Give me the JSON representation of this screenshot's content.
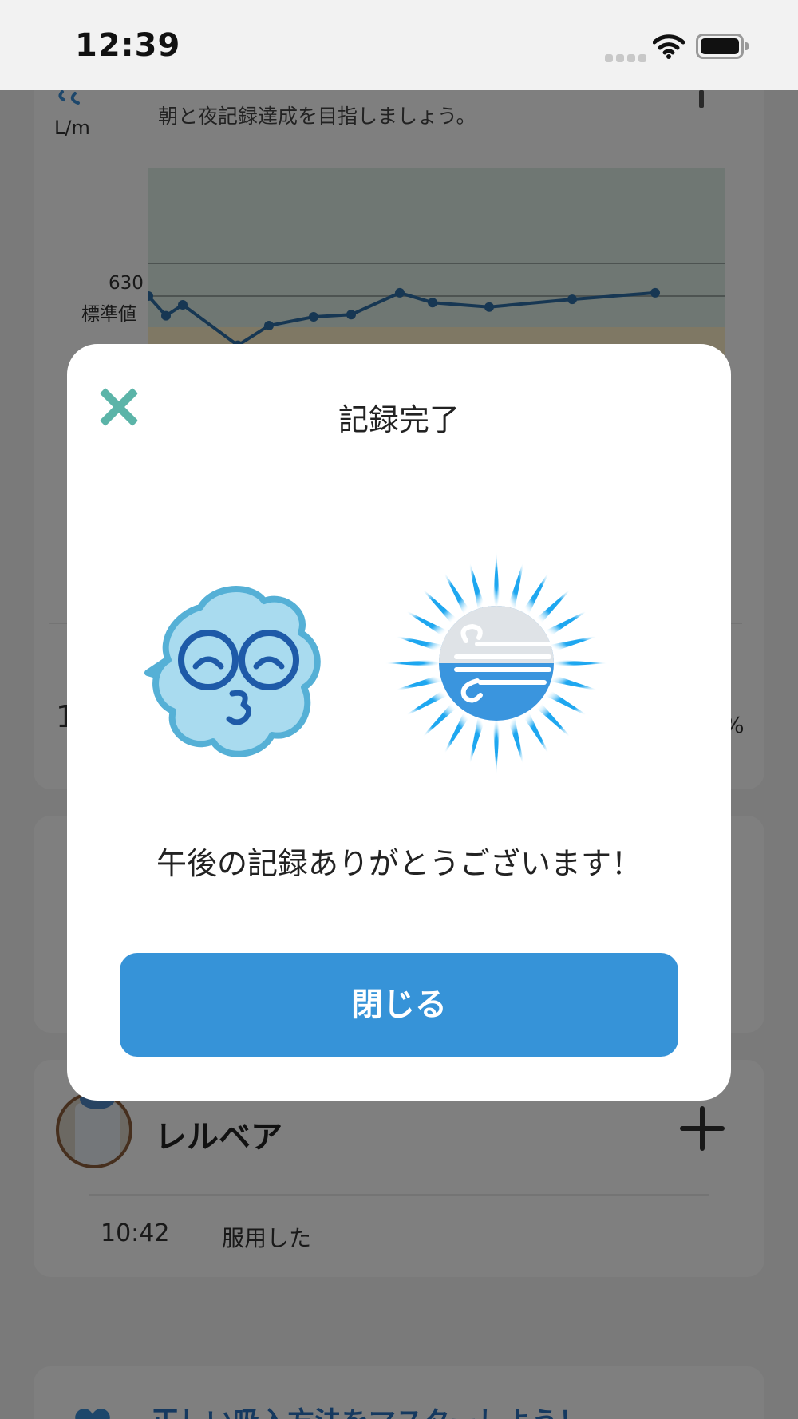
{
  "status_bar": {
    "time": "12:39"
  },
  "chart_card": {
    "unit": "L/m",
    "message": "朝と夜記録達成を目指しましょう。",
    "y_value_label": "630",
    "y_std_label": "標準値",
    "left_digit": "1",
    "right_suffix": "%"
  },
  "chart_data": {
    "type": "line",
    "y_reference": {
      "value": 630,
      "label": "標準値"
    },
    "series": [
      {
        "values": [
          630,
          612,
          622,
          585,
          603,
          611,
          613,
          633,
          624,
          620,
          627,
          633
        ]
      }
    ]
  },
  "medication": {
    "name": "レルベア",
    "time": "10:42",
    "status": "服用した"
  },
  "tip": {
    "text": "正しい吸入方法をマスターしよう！"
  },
  "modal": {
    "title": "記録完了",
    "message": "午後の記録ありがとうございます！",
    "close_button_label": "閉じる"
  },
  "colors": {
    "accent": "#3693d8",
    "close_icon": "#5bb4a8",
    "chart_line": "#2e6ea6"
  }
}
